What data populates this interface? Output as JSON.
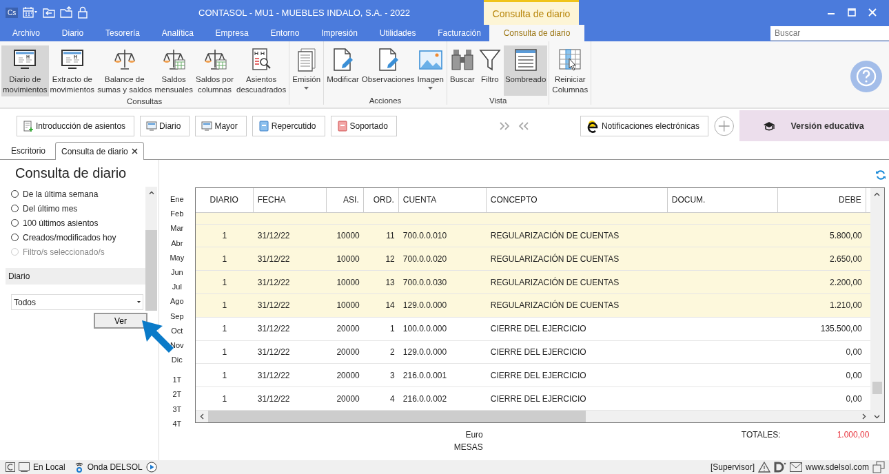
{
  "title_bar": {
    "logo": "Cs",
    "title": "CONTASOL - MU1 - MUEBLES INDALO, S.A. - 2022",
    "context_tab": "Consulta de diario"
  },
  "menu": [
    {
      "label": "Archivo",
      "selected": false
    },
    {
      "label": "Diario",
      "selected": false
    },
    {
      "label": "Tesorería",
      "selected": false
    },
    {
      "label": "Analítica",
      "selected": false
    },
    {
      "label": "Empresa",
      "selected": false
    },
    {
      "label": "Entorno",
      "selected": false
    },
    {
      "label": "Impresión",
      "selected": false
    },
    {
      "label": "Utilidades",
      "selected": false
    },
    {
      "label": "Facturación",
      "selected": false
    },
    {
      "label": "Consulta de diario",
      "selected": true
    }
  ],
  "search": {
    "placeholder": "Buscar"
  },
  "ribbon": [
    {
      "label": "Consultas",
      "items": [
        {
          "lines": [
            "Diario de",
            "movimientos"
          ],
          "kind": "monitor",
          "selected": true
        },
        {
          "lines": [
            "Extracto de",
            "movimientos"
          ],
          "kind": "monitor",
          "selected": false
        },
        {
          "lines": [
            "Balance de",
            "sumas y saldos"
          ],
          "kind": "scale",
          "selected": false
        },
        {
          "lines": [
            "Saldos",
            "mensuales"
          ],
          "kind": "scalegrid",
          "selected": false
        },
        {
          "lines": [
            "Saldos por",
            "columnas"
          ],
          "kind": "scalegrid",
          "selected": false
        },
        {
          "lines": [
            "Asientos",
            "descuadrados"
          ],
          "kind": "docsearch",
          "selected": false
        }
      ]
    },
    {
      "items": [
        {
          "lines": [
            "Emisión"
          ],
          "kind": "docstack",
          "selected": false,
          "dropdown": true
        }
      ]
    },
    {
      "label": "Acciones",
      "items": [
        {
          "lines": [
            "Modificar"
          ],
          "kind": "docpencil",
          "selected": false
        },
        {
          "lines": [
            "Observaciones"
          ],
          "kind": "docpencil",
          "selected": false
        },
        {
          "lines": [
            "Imagen"
          ],
          "kind": "image",
          "selected": false,
          "dropdown": true
        }
      ]
    },
    {
      "label": "Vista",
      "items": [
        {
          "lines": [
            "Buscar"
          ],
          "kind": "binoculars",
          "selected": false
        },
        {
          "lines": [
            "Filtro"
          ],
          "kind": "funnel",
          "selected": false
        },
        {
          "lines": [
            "Sombreado"
          ],
          "kind": "list",
          "selected": true
        }
      ]
    },
    {
      "items": [
        {
          "lines": [
            "Reiniciar",
            "Columnas"
          ],
          "kind": "columns",
          "selected": false
        }
      ]
    }
  ],
  "toolbar": [
    {
      "label": "Introducción de asientos",
      "kind": "form"
    },
    {
      "label": "Diario",
      "kind": "monitor"
    },
    {
      "label": "Mayor",
      "kind": "monitor"
    },
    {
      "label": "Repercutido",
      "kind": "bookblue"
    },
    {
      "label": "Soportado",
      "kind": "bookred"
    }
  ],
  "notifications_button": "Notificaciones electrónicas",
  "edition_banner": "Versión educativa",
  "doc_tabs": [
    {
      "label": "Escritorio",
      "selected": false,
      "closable": false
    },
    {
      "label": "Consulta de diario",
      "selected": true,
      "closable": true
    }
  ],
  "page_title": "Consulta de diario",
  "filters": [
    {
      "label": "De la última semana",
      "checked": false,
      "disabled": false
    },
    {
      "label": "Del último mes",
      "checked": false,
      "disabled": false
    },
    {
      "label": "100 últimos asientos",
      "checked": false,
      "disabled": false
    },
    {
      "label": "Creados/modificados hoy",
      "checked": false,
      "disabled": false
    },
    {
      "label": "Filtro/s seleccionado/s",
      "checked": false,
      "disabled": true
    }
  ],
  "diario_section": {
    "heading": "Diario",
    "value": "Todos",
    "button": "Ver"
  },
  "periods": [
    "Ene",
    "Feb",
    "Mar",
    "Abr",
    "May",
    "Jun",
    "Jul",
    "Ago",
    "Sep",
    "Oct",
    "Nov",
    "Dic",
    "1T",
    "2T",
    "3T",
    "4T"
  ],
  "table": {
    "columns": [
      "DIARIO",
      "FECHA",
      "ASI.",
      "ORD.",
      "CUENTA",
      "CONCEPTO",
      "DOCUM.",
      "DEBE"
    ],
    "rows": [
      {
        "diario": "1",
        "fecha": "31/12/22",
        "asiento": "10000",
        "orden": "11",
        "cuenta": "700.0.0.010",
        "concepto": "REGULARIZACIÓN DE CUENTAS",
        "debe": "5.800,00",
        "shaded": true
      },
      {
        "diario": "1",
        "fecha": "31/12/22",
        "asiento": "10000",
        "orden": "12",
        "cuenta": "700.0.0.020",
        "concepto": "REGULARIZACIÓN DE CUENTAS",
        "debe": "2.650,00",
        "shaded": true
      },
      {
        "diario": "1",
        "fecha": "31/12/22",
        "asiento": "10000",
        "orden": "13",
        "cuenta": "700.0.0.030",
        "concepto": "REGULARIZACIÓN DE CUENTAS",
        "debe": "2.200,00",
        "shaded": true
      },
      {
        "diario": "1",
        "fecha": "31/12/22",
        "asiento": "10000",
        "orden": "14",
        "cuenta": "129.0.0.000",
        "concepto": "REGULARIZACIÓN DE CUENTAS",
        "debe": "1.210,00",
        "shaded": true
      },
      {
        "diario": "1",
        "fecha": "31/12/22",
        "asiento": "20000",
        "orden": "1",
        "cuenta": "100.0.0.000",
        "concepto": "CIERRE DEL EJERCICIO",
        "debe": "135.500,00",
        "shaded": false
      },
      {
        "diario": "1",
        "fecha": "31/12/22",
        "asiento": "20000",
        "orden": "2",
        "cuenta": "129.0.0.000",
        "concepto": "CIERRE DEL EJERCICIO",
        "debe": "0,00",
        "shaded": false
      },
      {
        "diario": "1",
        "fecha": "31/12/22",
        "asiento": "20000",
        "orden": "3",
        "cuenta": "216.0.0.001",
        "concepto": "CIERRE DEL EJERCICIO",
        "debe": "0,00",
        "shaded": false
      },
      {
        "diario": "1",
        "fecha": "31/12/22",
        "asiento": "20000",
        "orden": "4",
        "cuenta": "216.0.0.002",
        "concepto": "CIERRE DEL EJERCICIO",
        "debe": "0,00",
        "shaded": false
      }
    ]
  },
  "footer": {
    "currency": "Euro",
    "ledger": "MESAS",
    "totals_label": "TOTALES:",
    "totals_value": "1.000,00"
  },
  "status_bar": {
    "mode": "En Local",
    "onda": "Onda DELSOL",
    "user": "[Supervisor]",
    "website": "www.sdelsol.com"
  }
}
